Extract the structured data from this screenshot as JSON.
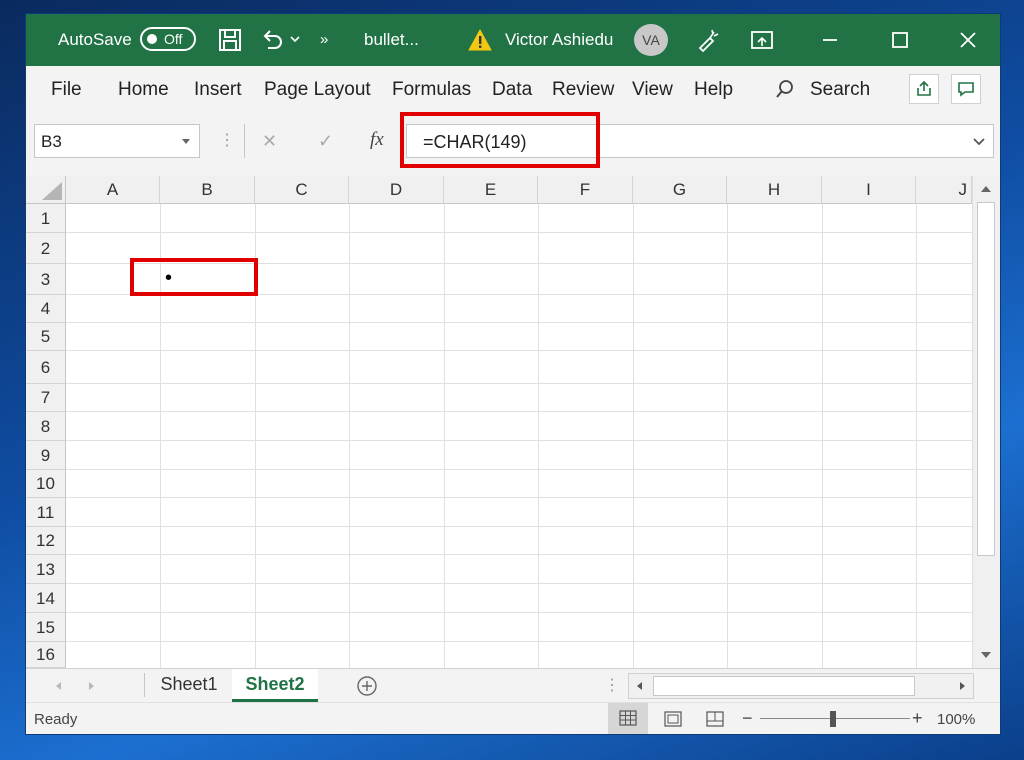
{
  "titlebar": {
    "autosave_label": "AutoSave",
    "autosave_state": "Off",
    "filename": "bullet...",
    "user_name": "Victor Ashiedu",
    "user_initials": "VA",
    "accent_color": "#217346"
  },
  "menu": {
    "items": [
      "File",
      "Home",
      "Insert",
      "Page Layout",
      "Formulas",
      "Data",
      "Review",
      "View",
      "Help"
    ],
    "search_label": "Search"
  },
  "formula_bar": {
    "name_box": "B3",
    "cancel_symbol": "✕",
    "enter_symbol": "✓",
    "fx_symbol": "fx",
    "formula": "=CHAR(149)"
  },
  "grid": {
    "columns": [
      "A",
      "B",
      "C",
      "D",
      "E",
      "F",
      "G",
      "H",
      "I",
      "J"
    ],
    "rows": [
      "1",
      "2",
      "3",
      "4",
      "5",
      "6",
      "7",
      "8",
      "9",
      "10",
      "11",
      "12",
      "13",
      "14",
      "15",
      "16"
    ],
    "cell_b3_value": "•",
    "highlight_color": "#e00000"
  },
  "sheets": {
    "tabs": [
      "Sheet1",
      "Sheet2"
    ],
    "active": "Sheet2"
  },
  "status": {
    "mode": "Ready",
    "zoom": "100%",
    "zoom_minus": "−",
    "zoom_plus": "+"
  }
}
